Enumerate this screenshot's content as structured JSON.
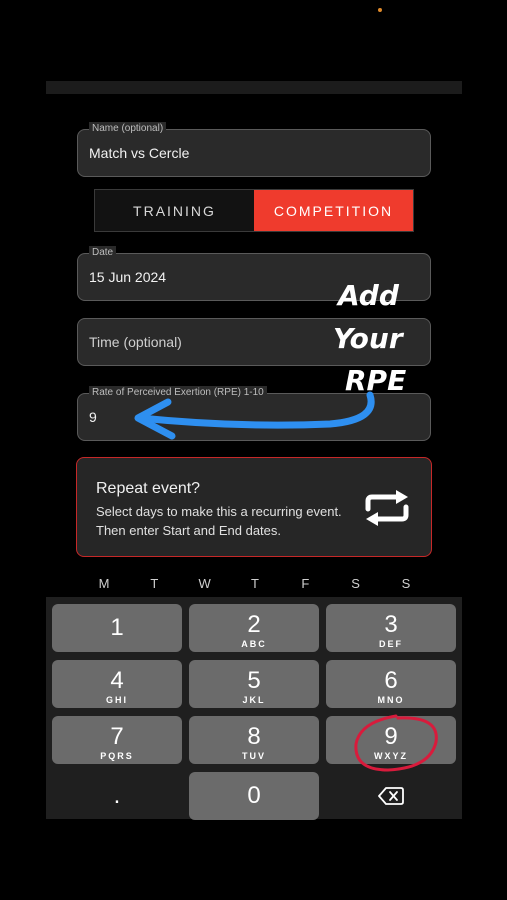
{
  "form": {
    "name": {
      "label": "Name (optional)",
      "value": "Match vs Cercle"
    },
    "type_toggle": {
      "options": [
        "TRAINING",
        "COMPETITION"
      ],
      "selected": "COMPETITION"
    },
    "date": {
      "label": "Date",
      "value": "15 Jun 2024"
    },
    "time": {
      "placeholder": "Time (optional)"
    },
    "rpe": {
      "label": "Rate of Perceived Exertion (RPE) 1-10",
      "value": "9"
    }
  },
  "repeat": {
    "title": "Repeat event?",
    "description": "Select days to make this a recurring event. Then enter Start and End dates.",
    "icon": "repeat-icon"
  },
  "weekdays": [
    "M",
    "T",
    "W",
    "T",
    "F",
    "S",
    "S"
  ],
  "keypad": {
    "keys": [
      {
        "digit": "1",
        "letters": ""
      },
      {
        "digit": "2",
        "letters": "ABC"
      },
      {
        "digit": "3",
        "letters": "DEF"
      },
      {
        "digit": "4",
        "letters": "GHI"
      },
      {
        "digit": "5",
        "letters": "JKL"
      },
      {
        "digit": "6",
        "letters": "MNO"
      },
      {
        "digit": "7",
        "letters": "PQRS"
      },
      {
        "digit": "8",
        "letters": "TUV"
      },
      {
        "digit": "9",
        "letters": "WXYZ"
      },
      {
        "digit": ".",
        "letters": ""
      },
      {
        "digit": "0",
        "letters": ""
      }
    ],
    "backspace_icon": "backspace-icon"
  },
  "annotation": {
    "lines": [
      "Add",
      "Your",
      "RPE"
    ]
  },
  "colors": {
    "accent": "#ef3b2d",
    "arrow": "#2e8ff0",
    "circle": "#d81b3c"
  }
}
